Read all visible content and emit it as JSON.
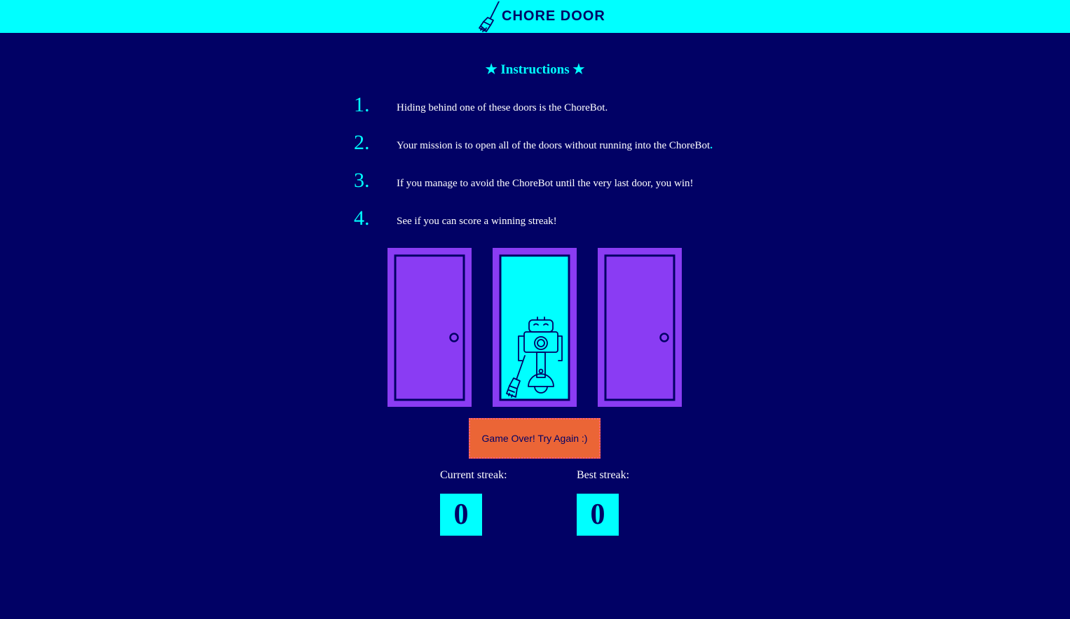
{
  "header": {
    "title": "CHORE DOOR",
    "logo_icon": "broom-icon",
    "background_color": "#00ffff"
  },
  "instructions": {
    "title": "★ Instructions ★",
    "items": [
      {
        "number": "1.",
        "text": "Hiding behind one of these doors is the ChoreBot."
      },
      {
        "number": "2.",
        "text": "Your mission is to open all of the doors without running into the ChoreBot"
      },
      {
        "number": "3.",
        "text": "If you manage to avoid the ChoreBot until the very last door, you win!"
      },
      {
        "number": "4.",
        "text": "See if you can score a winning streak!"
      }
    ],
    "item2_trailing": "."
  },
  "doors": [
    {
      "state": "closed",
      "icon": "closed-door-icon"
    },
    {
      "state": "open",
      "icon": "chorebot-icon"
    },
    {
      "state": "closed",
      "icon": "closed-door-icon"
    }
  ],
  "start_button": {
    "label": "Game Over! Try Again :)"
  },
  "scores": {
    "current_label": "Current streak:",
    "current_value": "0",
    "best_label": "Best streak:",
    "best_value": "0"
  },
  "colors": {
    "background": "#010165",
    "accent": "#00ffff",
    "door": "#8a3cf3",
    "button": "#eb6536"
  }
}
